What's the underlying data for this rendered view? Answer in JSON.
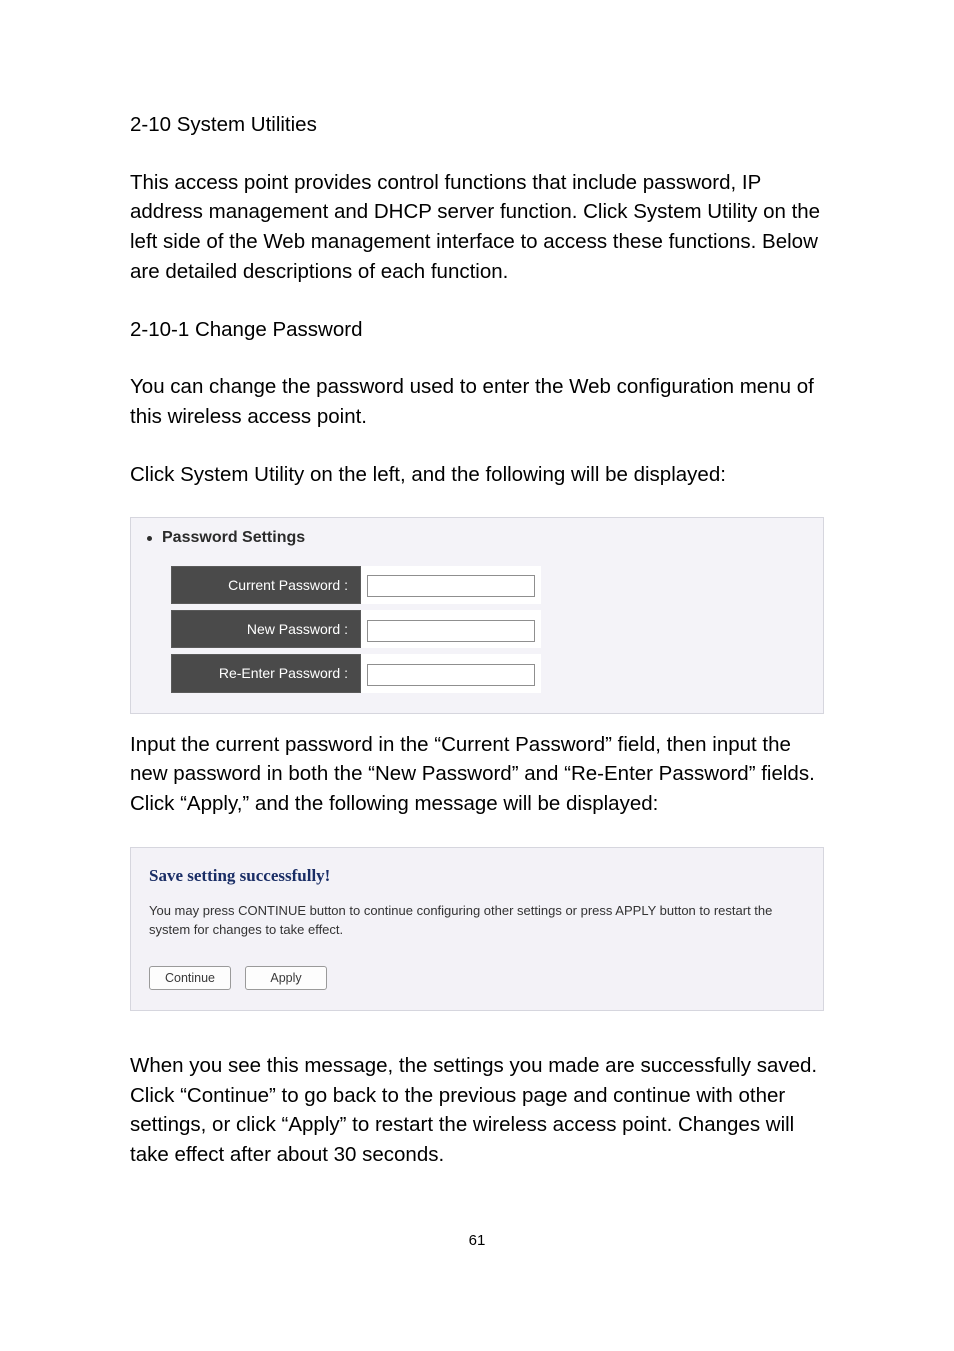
{
  "heading": "2-10 System Utilities",
  "intro": "This access point provides control functions that include password, IP address management and DHCP server function. Click System Utility on the left side of the Web management interface to access these functions. Below are detailed descriptions of each function.",
  "subHeading": "2-10-1 Change Password",
  "changeIntro": "You can change the password used to enter the Web configuration menu of this wireless access point.",
  "clickInstr": "Click System Utility on the left, and the following will be displayed:",
  "pwPanel": {
    "title": "Password Settings",
    "rows": [
      {
        "label": "Current Password :"
      },
      {
        "label": "New Password :"
      },
      {
        "label": "Re-Enter Password :"
      }
    ]
  },
  "afterPw": "Input the current password in the “Current Password” field, then input the new password in both the “New Password” and “Re-Enter Password” fields. Click “Apply,” and the following message will be displayed:",
  "savePanel": {
    "title": "Save setting successfully!",
    "message": "You may press CONTINUE button to continue configuring other settings or press APPLY button to restart the system for changes to take effect.",
    "continueBtn": "Continue",
    "applyBtn": "Apply"
  },
  "afterSave": "When you see this message, the settings you made are successfully saved. Click “Continue” to go back to the previous page and continue with other settings, or click “Apply” to restart the wireless access point. Changes will take effect after about 30 seconds.",
  "pageNumber": "61"
}
